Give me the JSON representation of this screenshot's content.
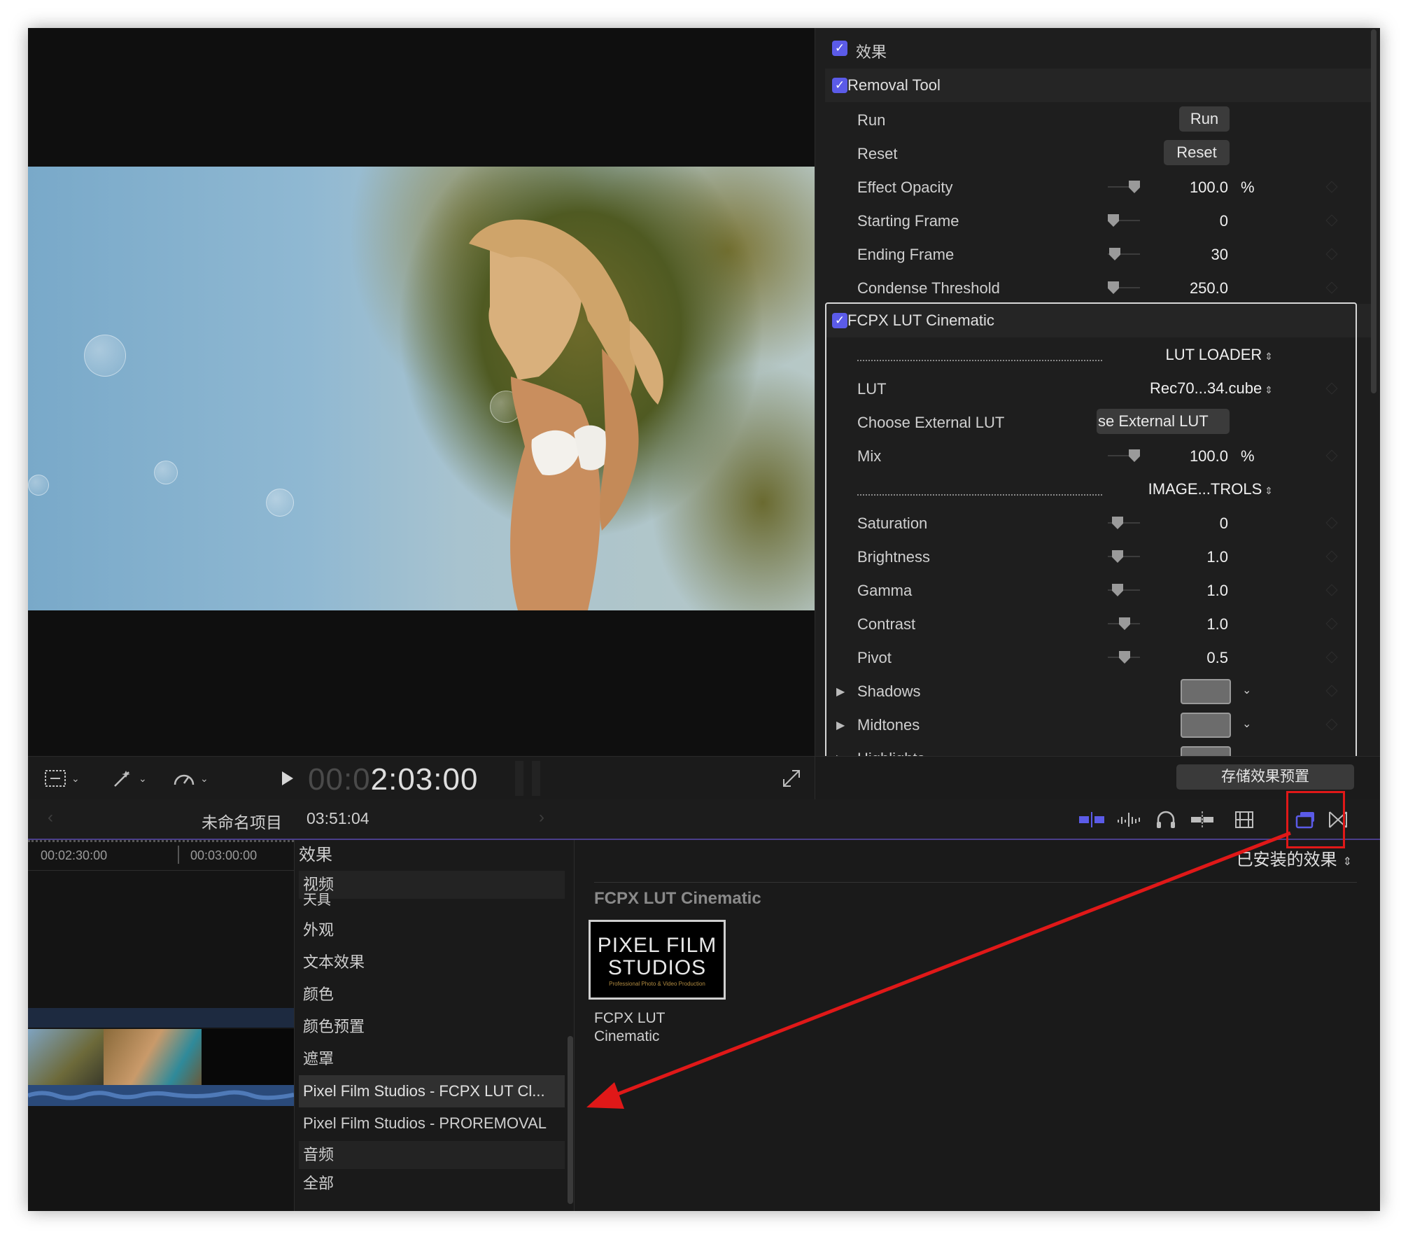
{
  "viewer": {
    "timecode_dim": "00:0",
    "timecode_lit": "2:03:00"
  },
  "inspector": {
    "effects_header": "效果",
    "removal_tool": {
      "title": "Removal Tool",
      "run_label": "Run",
      "run_button": "Run",
      "reset_label": "Reset",
      "reset_button": "Reset",
      "effect_opacity_label": "Effect Opacity",
      "effect_opacity_value": "100.0",
      "effect_opacity_unit": "%",
      "starting_frame_label": "Starting Frame",
      "starting_frame_value": "0",
      "ending_frame_label": "Ending Frame",
      "ending_frame_value": "30",
      "condense_threshold_label": "Condense Threshold",
      "condense_threshold_value": "250.0"
    },
    "lut_cinematic": {
      "title": "FCPX LUT Cinematic",
      "lut_loader_popup": "LUT LOADER",
      "lut_label": "LUT",
      "lut_value": "Rec70...34.cube",
      "choose_external_label": "Choose External LUT",
      "choose_external_button": "se External LUT",
      "mix_label": "Mix",
      "mix_value": "100.0",
      "mix_unit": "%",
      "image_controls_popup": "IMAGE...TROLS",
      "saturation_label": "Saturation",
      "saturation_value": "0",
      "brightness_label": "Brightness",
      "brightness_value": "1.0",
      "gamma_label": "Gamma",
      "gamma_value": "1.0",
      "contrast_label": "Contrast",
      "contrast_value": "1.0",
      "pivot_label": "Pivot",
      "pivot_value": "0.5",
      "shadows_label": "Shadows",
      "midtones_label": "Midtones",
      "highlights_label": "Highlights"
    },
    "save_preset_button": "存储效果预置"
  },
  "navbar": {
    "project_name": "未命名项目",
    "duration": "03:51:04"
  },
  "timeline": {
    "ruler_1": "00:02:30:00",
    "ruler_2": "00:03:00:00"
  },
  "effects_sidebar": {
    "header": "效果",
    "video_section": "视频",
    "items": [
      "天具",
      "外观",
      "文本效果",
      "颜色",
      "颜色预置",
      "遮罩",
      "Pixel Film Studios - FCPX LUT Cl...",
      "Pixel Film Studios - PROREMOVAL"
    ],
    "audio_section": "音频",
    "all_item": "全部"
  },
  "effects_browser": {
    "installed_popup": "已安装的效果",
    "section_title": "FCPX LUT Cinematic",
    "thumb_line1": "PIXEL FILM",
    "thumb_line2": "STUDIOS",
    "thumb_tagline": "Professional Photo & Video Production",
    "thumb_caption": "FCPX LUT Cinematic"
  },
  "colors": {
    "accent": "#5b5be8",
    "annotation_red": "#e01818"
  }
}
